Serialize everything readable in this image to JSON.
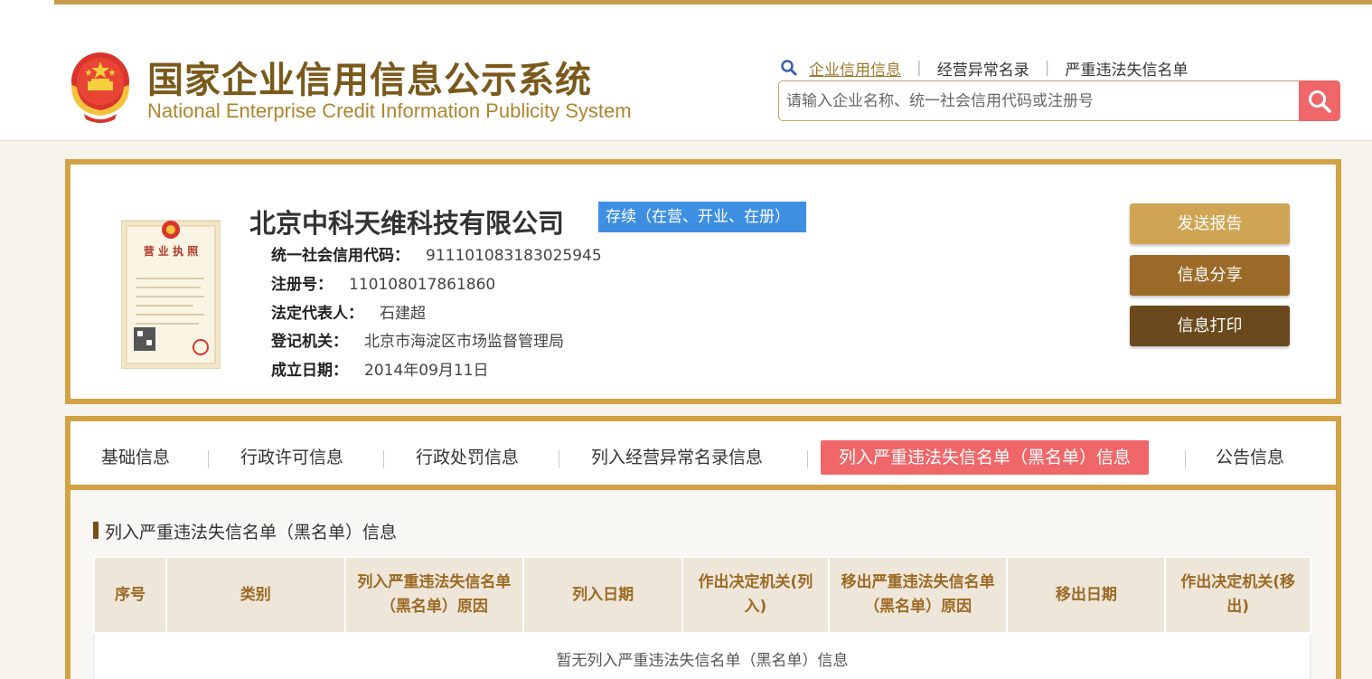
{
  "site": {
    "title_cn": "国家企业信用信息公示系统",
    "title_en": "National Enterprise Credit Information Publicity System"
  },
  "nav": {
    "links": [
      "企业信用信息",
      "经营异常名录",
      "严重违法失信名单"
    ],
    "separator": "|"
  },
  "search": {
    "placeholder": "请输入企业名称、统一社会信用代码或注册号",
    "value": ""
  },
  "company": {
    "name": "北京中科天维科技有限公司",
    "status": "存续（在营、开业、在册）",
    "fields": [
      {
        "label": "统一社会信用代码：",
        "value": "91110108318302594‌5"
      },
      {
        "label": "注册号：",
        "value": "110108017861860"
      },
      {
        "label": "法定代表人：",
        "value": "石建超"
      },
      {
        "label": "登记机关：",
        "value": "北京市海淀区市场监督管理局"
      },
      {
        "label": "成立日期：",
        "value": "2014年09月11日"
      }
    ]
  },
  "actions": {
    "send_report": "发送报告",
    "share": "信息分享",
    "print": "信息打印"
  },
  "tabs": [
    "基础信息",
    "行政许可信息",
    "行政处罚信息",
    "列入经营异常名录信息",
    "列入严重违法失信名单（黑名单）信息",
    "公告信息"
  ],
  "tab_separator": "|",
  "section": {
    "title": "列入严重违法失信名单（黑名单）信息",
    "columns": [
      "序号",
      "类别",
      "列入严重违法失信名单（黑名单）原因",
      "列入日期",
      "作出决定机关(列入)",
      "移出严重违法失信名单（黑名单）原因",
      "移出日期",
      "作出决定机关(移出)"
    ],
    "empty_text": "暂无列入严重违法失信名单（黑名单）信息"
  },
  "colors": {
    "gold": "#d2a245",
    "brown_dark": "#6a4a1c",
    "accent_red": "#f0676a",
    "status_blue": "#3e8fe2"
  }
}
